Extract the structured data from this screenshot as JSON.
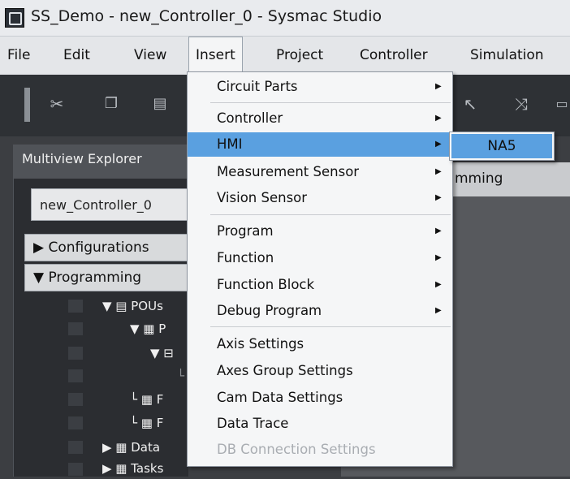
{
  "window": {
    "title": "SS_Demo - new_Controller_0 - Sysmac Studio"
  },
  "menubar": {
    "items": [
      "File",
      "Edit",
      "View",
      "Insert",
      "Project",
      "Controller",
      "Simulation"
    ]
  },
  "insert_menu": {
    "items": [
      {
        "label": "Circuit Parts",
        "submenu": true
      },
      {
        "label": "Controller",
        "submenu": true
      },
      {
        "label": "HMI",
        "submenu": true,
        "highlighted": true
      },
      {
        "label": "Measurement Sensor",
        "submenu": true
      },
      {
        "label": "Vision Sensor",
        "submenu": true
      },
      {
        "label": "Program",
        "submenu": true
      },
      {
        "label": "Function",
        "submenu": true
      },
      {
        "label": "Function Block",
        "submenu": true
      },
      {
        "label": "Debug Program",
        "submenu": true
      },
      {
        "label": "Axis Settings"
      },
      {
        "label": "Axes Group Settings"
      },
      {
        "label": "Cam Data Settings"
      },
      {
        "label": "Data Trace"
      },
      {
        "label": "DB Connection Settings",
        "disabled": true
      }
    ],
    "arrow_glyph": "▶"
  },
  "hmi_submenu": {
    "items": [
      "NA5"
    ]
  },
  "explorer": {
    "title": "Multiview Explorer",
    "controller_selector": "new_Controller_0",
    "sections": [
      "▶ Configurations",
      "▼ Programming"
    ],
    "tree": [
      {
        "label": "▼ ▤ POUs"
      },
      {
        "label": "▼ ▦ P"
      },
      {
        "label": "▼ ⊟"
      },
      {
        "label": "└"
      },
      {
        "label": "└ ▦ F"
      },
      {
        "label": "└ ▦ F"
      },
      {
        "label": "▶ ▦ Data"
      },
      {
        "label": "▶ ▦ Tasks"
      }
    ]
  },
  "right_pane": {
    "title": "mming"
  },
  "colors": {
    "highlight": "#5aa0e0",
    "toolbar": "#2e3135",
    "panel": "#2b2d31"
  }
}
